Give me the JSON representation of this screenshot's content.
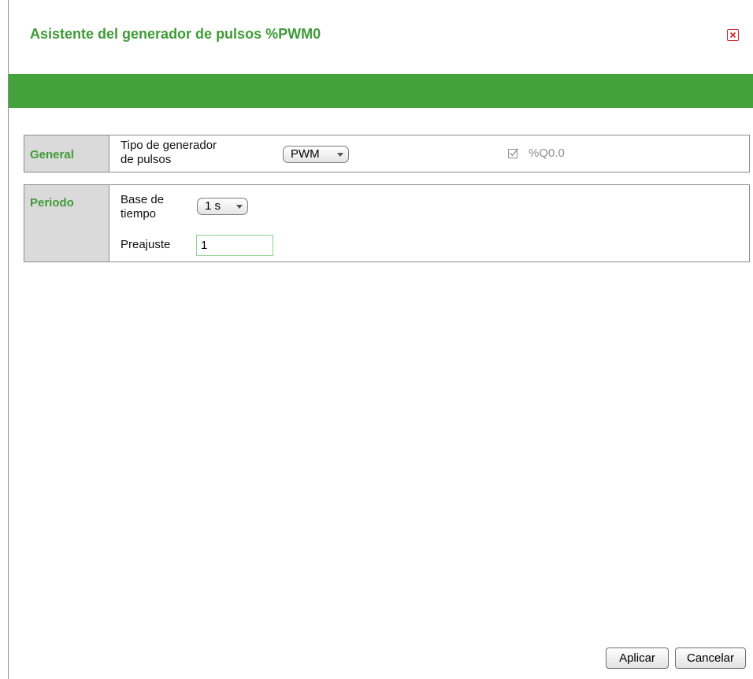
{
  "dialog": {
    "title": "Asistente del generador de pulsos %PWM0"
  },
  "general": {
    "label": "General",
    "pulse_type_label_line1": "Tipo de generador",
    "pulse_type_label_line2": "de pulsos",
    "pulse_type_value": "PWM",
    "output_checked": true,
    "output_label": "%Q0.0"
  },
  "periodo": {
    "label": "Periodo",
    "timebase_label_line1": "Base de",
    "timebase_label_line2": "tiempo",
    "timebase_value": "1 s",
    "preset_label": "Preajuste",
    "preset_value": "1"
  },
  "footer": {
    "apply_label": "Aplicar",
    "cancel_label": "Cancelar"
  },
  "colors": {
    "accent_green": "#43a33a",
    "title_green": "#3d9b35",
    "close_red": "#d2232a"
  },
  "icons": {
    "close": "close-icon",
    "checkbox": "checkbox-checked-icon",
    "dropdown_arrow": "chevron-down-icon"
  }
}
